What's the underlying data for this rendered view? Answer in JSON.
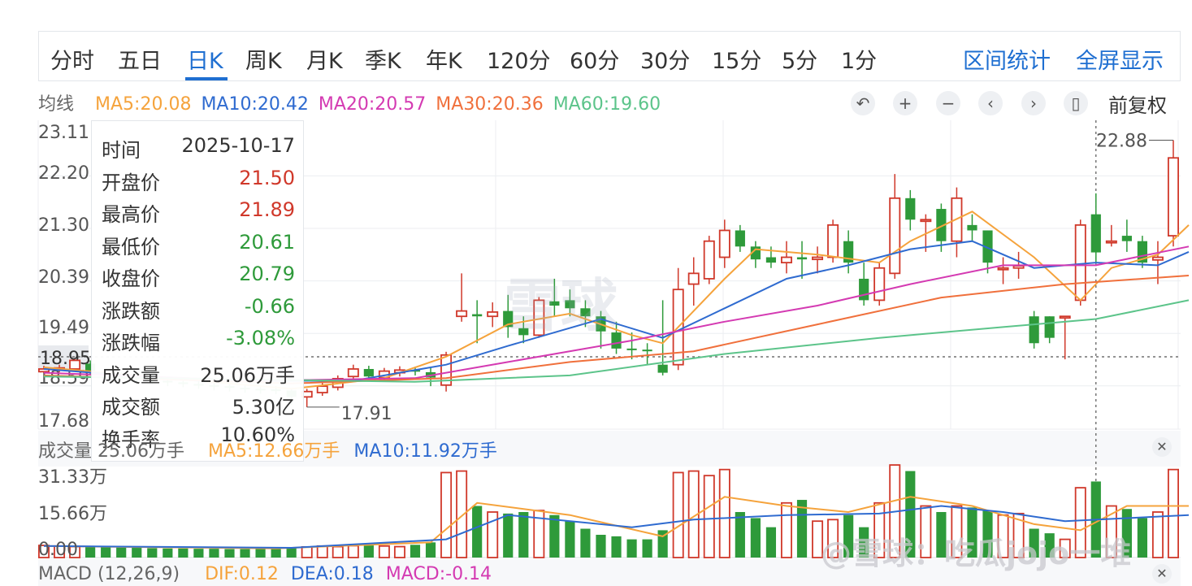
{
  "tabs": [
    "分时",
    "五日",
    "日K",
    "周K",
    "月K",
    "季K",
    "年K",
    "120分",
    "60分",
    "30分",
    "15分",
    "5分",
    "1分"
  ],
  "active_tab": "日K",
  "right_tabs": [
    "区间统计",
    "全屏显示"
  ],
  "ma": {
    "label": "均线",
    "items": [
      {
        "text": "MA5:20.08",
        "color": "#f5a33c"
      },
      {
        "text": "MA10:20.42",
        "color": "#2f6bd0"
      },
      {
        "text": "MA20:20.57",
        "color": "#d43ab2"
      },
      {
        "text": "MA30:20.36",
        "color": "#f0703c"
      },
      {
        "text": "MA60:19.60",
        "color": "#5cc48a"
      }
    ]
  },
  "controls": {
    "icons": [
      "undo-icon",
      "zoom-in-icon",
      "zoom-out-icon",
      "left-arrow-icon",
      "right-arrow-icon",
      "candle-icon"
    ],
    "glyphs": [
      "↶",
      "+",
      "−",
      "‹",
      "›",
      "▯"
    ],
    "adjust": "前复权"
  },
  "tooltip": {
    "rows": [
      {
        "k": "时间",
        "v": "2025-10-17",
        "c": "#333333"
      },
      {
        "k": "开盘价",
        "v": "21.50",
        "c": "#d0382a"
      },
      {
        "k": "最高价",
        "v": "21.89",
        "c": "#d0382a"
      },
      {
        "k": "最低价",
        "v": "20.61",
        "c": "#2e9a3a"
      },
      {
        "k": "收盘价",
        "v": "20.79",
        "c": "#2e9a3a"
      },
      {
        "k": "涨跌额",
        "v": "-0.66",
        "c": "#2e9a3a"
      },
      {
        "k": "涨跌幅",
        "v": "-3.08%",
        "c": "#2e9a3a"
      },
      {
        "k": "成交量",
        "v": "25.06万手",
        "c": "#333333"
      },
      {
        "k": "成交额",
        "v": "5.30亿",
        "c": "#333333"
      },
      {
        "k": "换手率",
        "v": "10.60%",
        "c": "#333333"
      }
    ]
  },
  "volume": {
    "label": "成交量 25.06万手",
    "ma5": "MA5:12.66万手",
    "ma10": "MA10:11.92万手",
    "ma5_color": "#f5a33c",
    "ma10_color": "#2f6bd0"
  },
  "macd": {
    "label": "MACD (12,26,9)",
    "dif": "DIF:0.12",
    "dea": "DEA:0.18",
    "macd": "MACD:-0.14",
    "dif_color": "#f5a33c",
    "dea_color": "#2f6bd0",
    "macd_color": "#d43ab2"
  },
  "watermark": "雪球",
  "watermark2": "@雪球：吃瓜jojo一堆",
  "colors": {
    "up": "#d0382a",
    "down": "#2e9a3a",
    "grid": "#eceef1",
    "accent": "#1f6fd1"
  },
  "chart_data": {
    "type": "candlestick",
    "price_ticks": [
      "23.11",
      "22.20",
      "21.30",
      "20.39",
      "19.49",
      "18.95",
      "18.59",
      "17.68"
    ],
    "current_price": "18.95",
    "max_label": "22.88",
    "min_label": "17.91",
    "volume_ticks": [
      "31.33万",
      "15.66万",
      "0.00"
    ],
    "candles": [
      [
        18.57,
        18.62,
        18.55,
        18.68
      ],
      [
        18.6,
        18.64,
        18.56,
        18.7
      ],
      [
        18.62,
        18.78,
        18.58,
        18.8
      ],
      [
        18.72,
        18.55,
        18.5,
        18.78
      ],
      [
        18.55,
        18.52,
        18.45,
        18.6
      ],
      [
        18.5,
        18.48,
        18.42,
        18.56
      ],
      [
        18.48,
        18.44,
        18.38,
        18.54
      ],
      [
        18.44,
        18.4,
        18.34,
        18.5
      ],
      [
        18.4,
        18.37,
        18.3,
        18.47
      ],
      [
        18.37,
        18.34,
        18.28,
        18.44
      ],
      [
        18.34,
        18.32,
        18.25,
        18.4
      ],
      [
        18.32,
        18.3,
        18.22,
        18.38
      ],
      [
        18.3,
        18.27,
        18.2,
        18.36
      ],
      [
        18.27,
        18.25,
        18.18,
        18.34
      ],
      [
        18.25,
        18.24,
        18.16,
        18.32
      ],
      [
        18.24,
        18.22,
        18.15,
        18.3
      ],
      [
        18.22,
        18.1,
        17.95,
        18.26
      ],
      [
        18.1,
        18.2,
        17.91,
        18.25
      ],
      [
        18.18,
        18.3,
        18.12,
        18.36
      ],
      [
        18.28,
        18.44,
        18.22,
        18.5
      ],
      [
        18.48,
        18.62,
        18.4,
        18.7
      ],
      [
        18.62,
        18.48,
        18.42,
        18.68
      ],
      [
        18.46,
        18.58,
        18.4,
        18.64
      ],
      [
        18.55,
        18.6,
        18.48,
        18.67
      ],
      [
        18.6,
        18.58,
        18.5,
        18.66
      ],
      [
        18.56,
        18.46,
        18.3,
        18.64
      ],
      [
        18.32,
        18.88,
        18.2,
        18.94
      ],
      [
        19.6,
        19.7,
        19.5,
        20.4
      ],
      [
        19.64,
        19.6,
        19.1,
        19.9
      ],
      [
        19.6,
        19.68,
        19.4,
        19.86
      ],
      [
        19.7,
        19.4,
        19.2,
        20.0
      ],
      [
        19.38,
        19.25,
        19.1,
        19.6
      ],
      [
        19.25,
        19.9,
        19.2,
        19.96
      ],
      [
        19.88,
        19.8,
        19.6,
        20.3
      ],
      [
        19.9,
        19.75,
        19.6,
        20.1
      ],
      [
        19.75,
        19.6,
        19.4,
        19.9
      ],
      [
        19.6,
        19.32,
        19.0,
        19.7
      ],
      [
        19.3,
        19.0,
        18.9,
        19.5
      ],
      [
        19.0,
        18.98,
        18.8,
        19.3
      ],
      [
        18.98,
        18.96,
        18.7,
        19.1
      ],
      [
        18.7,
        18.55,
        18.5,
        19.9
      ],
      [
        18.7,
        20.1,
        18.6,
        20.5
      ],
      [
        20.2,
        20.4,
        19.8,
        20.7
      ],
      [
        20.3,
        21.0,
        20.2,
        21.1
      ],
      [
        20.7,
        21.2,
        20.5,
        21.4
      ],
      [
        21.2,
        20.9,
        20.8,
        21.3
      ],
      [
        20.9,
        20.66,
        20.5,
        21.0
      ],
      [
        20.7,
        20.6,
        20.5,
        20.9
      ],
      [
        20.6,
        20.7,
        20.4,
        21.0
      ],
      [
        20.7,
        20.66,
        20.3,
        21.0
      ],
      [
        20.66,
        20.7,
        20.4,
        20.9
      ],
      [
        20.7,
        21.3,
        20.6,
        21.4
      ],
      [
        21.0,
        20.6,
        20.4,
        21.2
      ],
      [
        20.3,
        19.9,
        19.8,
        20.6
      ],
      [
        19.9,
        20.5,
        19.8,
        20.6
      ],
      [
        20.4,
        21.8,
        20.3,
        22.25
      ],
      [
        21.8,
        21.4,
        21.2,
        21.95
      ],
      [
        21.4,
        21.4,
        20.8,
        21.5
      ],
      [
        21.6,
        21.0,
        20.8,
        21.7
      ],
      [
        21.0,
        21.8,
        20.7,
        22.0
      ],
      [
        21.3,
        21.2,
        21.0,
        21.5
      ],
      [
        21.2,
        20.6,
        20.4,
        21.2
      ],
      [
        20.5,
        20.5,
        20.2,
        20.7
      ],
      [
        20.5,
        20.54,
        20.3,
        20.8
      ],
      [
        19.6,
        19.1,
        19.0,
        19.7
      ],
      [
        19.6,
        19.2,
        19.1,
        19.6
      ],
      [
        19.6,
        19.6,
        18.8,
        19.6
      ],
      [
        19.9,
        21.3,
        19.8,
        21.4
      ],
      [
        21.5,
        20.79,
        20.61,
        21.89
      ],
      [
        21.0,
        21.0,
        20.9,
        21.3
      ],
      [
        21.1,
        21.0,
        20.8,
        21.4
      ],
      [
        21.0,
        20.6,
        20.5,
        21.1
      ],
      [
        20.65,
        20.7,
        20.2,
        21.0
      ],
      [
        21.1,
        22.55,
        20.9,
        22.88
      ]
    ],
    "volumes": [
      4.0,
      3.8,
      3.6,
      3.5,
      3.4,
      3.3,
      3.2,
      3.1,
      3.0,
      3.0,
      2.9,
      2.9,
      2.8,
      2.8,
      2.8,
      2.8,
      3.2,
      3.5,
      3.8,
      3.6,
      3.9,
      4.0,
      3.8,
      3.6,
      4.2,
      5.0,
      28.0,
      28.5,
      17.0,
      15.0,
      14.5,
      15.0,
      15.5,
      14.0,
      12.0,
      9.5,
      7.5,
      7.0,
      6.0,
      6.0,
      9.0,
      28.0,
      28.5,
      27.0,
      29.0,
      15.0,
      13.0,
      10.0,
      18.0,
      19.0,
      12.0,
      12.5,
      14.0,
      10.0,
      18.0,
      30.5,
      28.5,
      17.0,
      15.0,
      17.0,
      16.5,
      15.5,
      14.0,
      14.5,
      9.5,
      8.0,
      6.0,
      23.0,
      25.06,
      17.0,
      16.0,
      13.0,
      15.0,
      29.0
    ],
    "ma": {
      "MA5": [
        [
          0,
          18.65
        ],
        [
          8,
          18.45
        ],
        [
          16,
          18.25
        ],
        [
          22,
          18.45
        ],
        [
          26,
          18.85
        ],
        [
          30,
          19.45
        ],
        [
          34,
          19.65
        ],
        [
          38,
          19.25
        ],
        [
          40,
          19.1
        ],
        [
          44,
          20.3
        ],
        [
          46,
          20.85
        ],
        [
          50,
          20.75
        ],
        [
          54,
          20.6
        ],
        [
          56,
          21.0
        ],
        [
          60,
          21.55
        ],
        [
          64,
          20.7
        ],
        [
          67,
          19.9
        ],
        [
          69,
          20.5
        ],
        [
          72,
          20.75
        ],
        [
          74,
          21.3
        ]
      ],
      "MA10": [
        [
          0,
          18.62
        ],
        [
          10,
          18.4
        ],
        [
          20,
          18.4
        ],
        [
          26,
          18.7
        ],
        [
          30,
          19.05
        ],
        [
          36,
          19.55
        ],
        [
          40,
          19.2
        ],
        [
          44,
          19.75
        ],
        [
          48,
          20.3
        ],
        [
          52,
          20.55
        ],
        [
          56,
          20.85
        ],
        [
          60,
          21.0
        ],
        [
          64,
          20.5
        ],
        [
          68,
          20.6
        ],
        [
          72,
          20.55
        ],
        [
          74,
          20.8
        ]
      ],
      "MA20": [
        [
          0,
          18.55
        ],
        [
          14,
          18.4
        ],
        [
          24,
          18.45
        ],
        [
          30,
          18.75
        ],
        [
          38,
          19.15
        ],
        [
          44,
          19.5
        ],
        [
          50,
          19.8
        ],
        [
          56,
          20.2
        ],
        [
          62,
          20.55
        ],
        [
          68,
          20.55
        ],
        [
          74,
          20.9
        ]
      ],
      "MA30": [
        [
          0,
          18.5
        ],
        [
          16,
          18.35
        ],
        [
          26,
          18.45
        ],
        [
          34,
          18.75
        ],
        [
          42,
          18.95
        ],
        [
          50,
          19.45
        ],
        [
          58,
          19.95
        ],
        [
          66,
          20.2
        ],
        [
          74,
          20.36
        ]
      ],
      "MA60": [
        [
          0,
          18.48
        ],
        [
          24,
          18.38
        ],
        [
          34,
          18.5
        ],
        [
          44,
          18.9
        ],
        [
          54,
          19.2
        ],
        [
          62,
          19.4
        ],
        [
          68,
          19.55
        ],
        [
          74,
          19.9
        ]
      ]
    },
    "volume_ma": {
      "MA5": [
        [
          0,
          3.8
        ],
        [
          15,
          3.0
        ],
        [
          25,
          5.0
        ],
        [
          28,
          18.0
        ],
        [
          34,
          14.0
        ],
        [
          40,
          7.0
        ],
        [
          44,
          20.0
        ],
        [
          48,
          17.0
        ],
        [
          52,
          15.0
        ],
        [
          56,
          20.0
        ],
        [
          60,
          17.0
        ],
        [
          64,
          11.0
        ],
        [
          67,
          9.0
        ],
        [
          70,
          17.0
        ],
        [
          74,
          17.0
        ]
      ],
      "MA10": [
        [
          0,
          3.8
        ],
        [
          16,
          3.2
        ],
        [
          26,
          6.0
        ],
        [
          30,
          14.0
        ],
        [
          38,
          10.0
        ],
        [
          42,
          12.5
        ],
        [
          48,
          14.0
        ],
        [
          54,
          14.5
        ],
        [
          58,
          17.0
        ],
        [
          62,
          15.0
        ],
        [
          66,
          12.0
        ],
        [
          70,
          13.0
        ],
        [
          74,
          14.0
        ]
      ]
    },
    "price_range": [
      17.5,
      23.25
    ]
  }
}
